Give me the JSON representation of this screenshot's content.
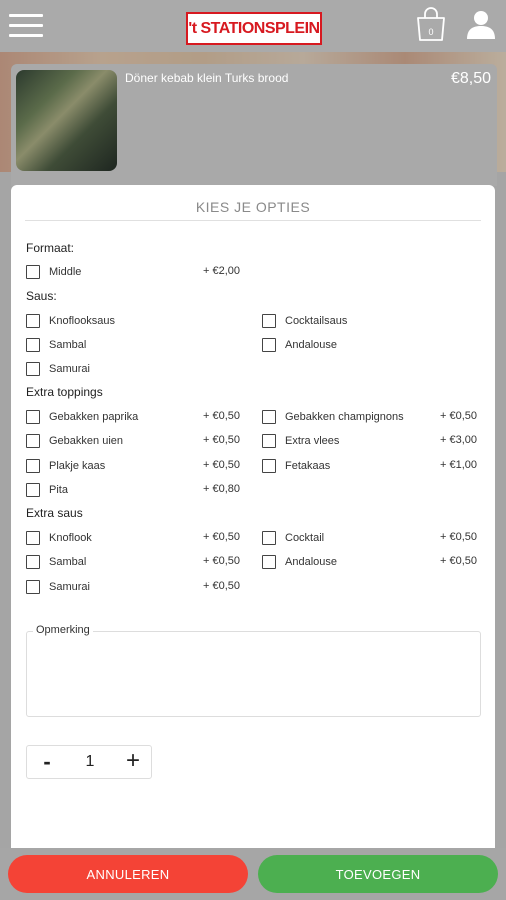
{
  "header": {
    "logo_text": "'t STATIONSPLEIN",
    "cart_count": "0"
  },
  "product": {
    "name": "Döner kebab klein Turks brood",
    "price": "€8,50"
  },
  "panel": {
    "title": "KIES JE OPTIES",
    "sections": {
      "formaat": {
        "label": "Formaat:",
        "middle": {
          "label": "Middle",
          "price": "+ €2,00"
        }
      },
      "saus": {
        "label": "Saus:",
        "knoflooksaus": "Knoflooksaus",
        "cocktailsaus": "Cocktailsaus",
        "sambal": "Sambal",
        "andalouse": "Andalouse",
        "samurai": "Samurai"
      },
      "extra_toppings": {
        "label": "Extra toppings",
        "gebakken_paprika": {
          "label": "Gebakken paprika",
          "price": "+ €0,50"
        },
        "gebakken_champignons": {
          "label": "Gebakken champignons",
          "price": "+ €0,50"
        },
        "gebakken_uien": {
          "label": "Gebakken uien",
          "price": "+ €0,50"
        },
        "extra_vlees": {
          "label": "Extra vlees",
          "price": "+ €3,00"
        },
        "plakje_kaas": {
          "label": "Plakje kaas",
          "price": "+ €0,50"
        },
        "fetakaas": {
          "label": "Fetakaas",
          "price": "+ €1,00"
        },
        "pita": {
          "label": "Pita",
          "price": "+ €0,80"
        }
      },
      "extra_saus": {
        "label": "Extra saus",
        "knoflook": {
          "label": "Knoflook",
          "price": "+ €0,50"
        },
        "cocktail": {
          "label": "Cocktail",
          "price": "+ €0,50"
        },
        "sambal": {
          "label": "Sambal",
          "price": "+ €0,50"
        },
        "andalouse": {
          "label": "Andalouse",
          "price": "+ €0,50"
        },
        "samurai": {
          "label": "Samurai",
          "price": "+ €0,50"
        }
      }
    },
    "remark_label": "Opmerking",
    "quantity": {
      "minus": "-",
      "value": "1",
      "plus": "+"
    }
  },
  "footer": {
    "cancel_label": "ANNULEREN",
    "add_label": "TOEVOEGEN"
  },
  "colors": {
    "cancel": "#f44336",
    "add": "#4caf50",
    "logo_red": "#d71920"
  }
}
